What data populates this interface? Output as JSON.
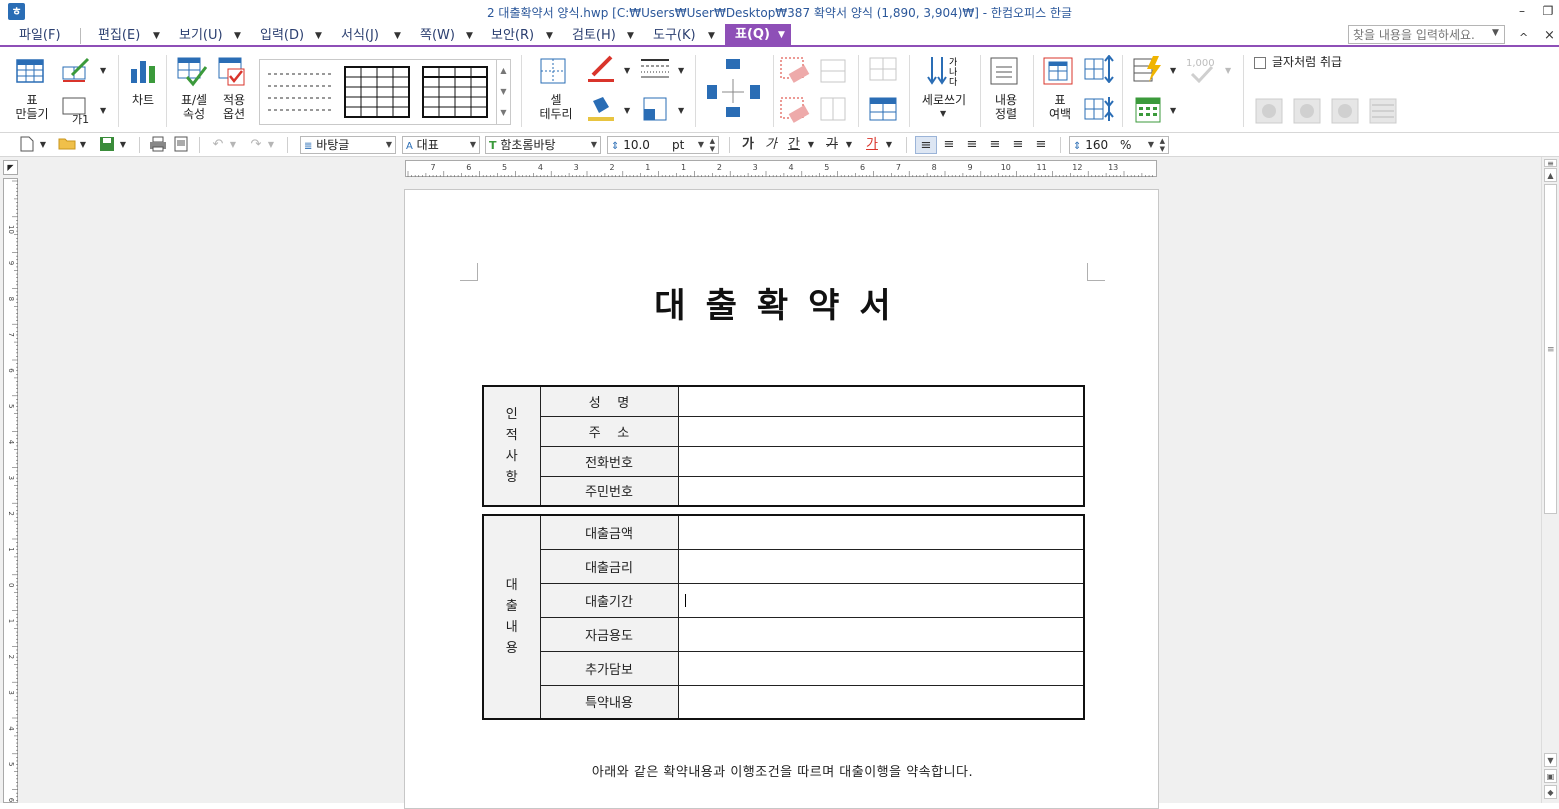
{
  "titlebar": {
    "app_icon": "hwp-app-icon",
    "title": "2 대출확약서 양식.hwp [C:₩Users₩User₩Desktop₩387 확약서 양식 (1,890, 3,904)₩] - 한컴오피스 한글",
    "minimize": "–",
    "restore": "❐"
  },
  "menu": {
    "items": [
      "파일(F)",
      "편집(E)",
      "보기(U)",
      "입력(D)",
      "서식(J)",
      "쪽(W)",
      "보안(R)",
      "검토(H)",
      "도구(K)",
      "표(Q)"
    ],
    "active": "표(Q)",
    "search_placeholder": "찾을 내용을 입력하세요.",
    "collapse": "^",
    "close": "×"
  },
  "ribbon": {
    "make_table": "표\n만들기",
    "text_box_label": "가1",
    "chart": "차트",
    "table_cell_props": "표/셀\n속성",
    "apply_options": "적용\n옵션",
    "cell_border": "셀\n테두리",
    "vertical_text": "세로쓰기",
    "align_content": "내용\n정렬",
    "table_margin": "표\n여백",
    "number_format": "1,000",
    "treat_as_char": "글자처럼 취급"
  },
  "format_toolbar": {
    "style": "바탕글",
    "language": "대표",
    "font": "함초롬바탕",
    "font_size": "10.0",
    "size_unit": "pt",
    "bold": "가",
    "italic": "가",
    "underline": "간",
    "strike": "가",
    "color": "가",
    "line_spacing": "160",
    "line_spacing_unit": "%"
  },
  "ruler": {
    "h_labels": [
      "7",
      "6",
      "5",
      "4",
      "3",
      "2",
      "1",
      "1",
      "2",
      "3",
      "4",
      "5",
      "6",
      "7",
      "8",
      "9",
      "10",
      "11",
      "12",
      "13"
    ],
    "v_labels": [
      "10",
      "9",
      "8",
      "7",
      "6",
      "5",
      "4",
      "3",
      "2",
      "1",
      "0",
      "1",
      "2",
      "3",
      "4",
      "5",
      "6"
    ]
  },
  "document": {
    "title": "대출확약서",
    "personal": {
      "group_label": [
        "인",
        "적",
        "사",
        "항"
      ],
      "rows": [
        "성    명",
        "주    소",
        "전화번호",
        "주민번호"
      ]
    },
    "loan": {
      "group_label": [
        "대",
        "출",
        "내",
        "용"
      ],
      "rows": [
        "대출금액",
        "대출금리",
        "대출기간",
        "자금용도",
        "추가담보",
        "특약내용"
      ]
    },
    "statement": "아래와 같은 확약내용과 이행조건을 따르며 대출이행을 약속합니다."
  },
  "colors": {
    "accent": "#8e4fb7",
    "title_text": "#2b579a",
    "workspace": "#f0f0f0"
  }
}
